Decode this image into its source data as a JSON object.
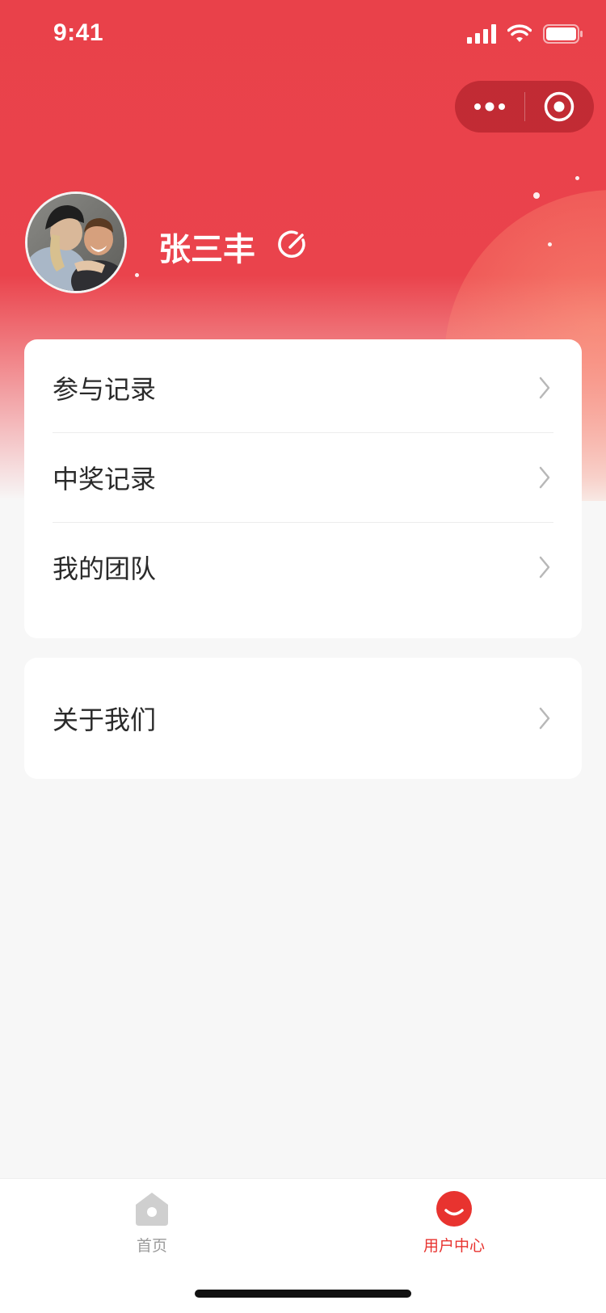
{
  "status_bar": {
    "time": "9:41"
  },
  "profile": {
    "name": "张三丰"
  },
  "menu_primary": [
    {
      "label": "参与记录"
    },
    {
      "label": "中奖记录"
    },
    {
      "label": "我的团队"
    }
  ],
  "menu_secondary": [
    {
      "label": "关于我们"
    }
  ],
  "tabbar": {
    "items": [
      {
        "label": "首页",
        "active": false
      },
      {
        "label": "用户中心",
        "active": true
      }
    ]
  },
  "colors": {
    "brand_red": "#e9414a",
    "tab_active": "#e8332f",
    "tab_inactive": "#9b9b9b"
  }
}
